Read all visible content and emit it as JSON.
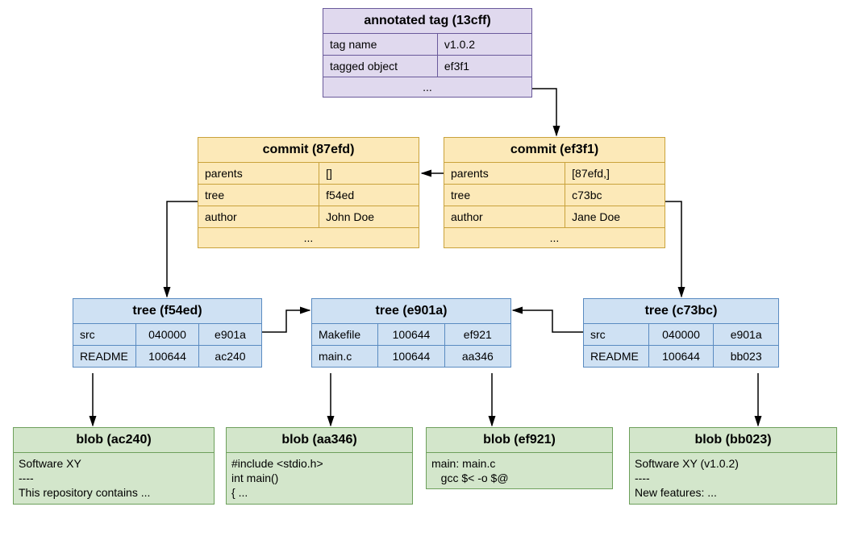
{
  "tag": {
    "title": "annotated tag (13cff)",
    "rows": [
      {
        "k": "tag name",
        "v": "v1.0.2"
      },
      {
        "k": "tagged object",
        "v": "ef3f1"
      }
    ],
    "more": "..."
  },
  "commits": {
    "c1": {
      "title": "commit (87efd)",
      "rows": [
        {
          "k": "parents",
          "v": "[]"
        },
        {
          "k": "tree",
          "v": "f54ed"
        },
        {
          "k": "author",
          "v": "John Doe"
        }
      ],
      "more": "..."
    },
    "c2": {
      "title": "commit (ef3f1)",
      "rows": [
        {
          "k": "parents",
          "v": "[87efd,]"
        },
        {
          "k": "tree",
          "v": "c73bc"
        },
        {
          "k": "author",
          "v": "Jane Doe"
        }
      ],
      "more": "..."
    }
  },
  "trees": {
    "t1": {
      "title": "tree (f54ed)",
      "entries": [
        {
          "name": "src",
          "mode": "040000",
          "sha": "e901a"
        },
        {
          "name": "README",
          "mode": "100644",
          "sha": "ac240"
        }
      ]
    },
    "t2": {
      "title": "tree (e901a)",
      "entries": [
        {
          "name": "Makefile",
          "mode": "100644",
          "sha": "ef921"
        },
        {
          "name": "main.c",
          "mode": "100644",
          "sha": "aa346"
        }
      ]
    },
    "t3": {
      "title": "tree (c73bc)",
      "entries": [
        {
          "name": "src",
          "mode": "040000",
          "sha": "e901a"
        },
        {
          "name": "README",
          "mode": "100644",
          "sha": "bb023"
        }
      ]
    }
  },
  "blobs": {
    "b1": {
      "title": "blob (ac240)",
      "content": "Software XY\n----\nThis repository contains ..."
    },
    "b2": {
      "title": "blob (aa346)",
      "content": "#include <stdio.h>\nint main()\n{ ..."
    },
    "b3": {
      "title": "blob (ef921)",
      "content": "main: main.c\n   gcc $< -o $@"
    },
    "b4": {
      "title": "blob (bb023)",
      "content": "Software XY (v1.0.2)\n----\nNew features: ..."
    }
  }
}
